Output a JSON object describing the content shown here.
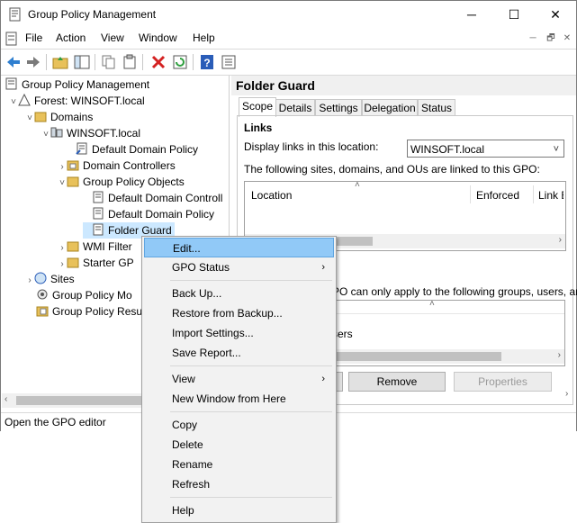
{
  "window": {
    "title": "Group Policy Management",
    "controls": {
      "minimize": "─",
      "maximize": "☐",
      "close": "✕"
    }
  },
  "menubar": {
    "items": [
      "File",
      "Action",
      "View",
      "Window",
      "Help"
    ],
    "mdi": {
      "minimize": "─",
      "restore": "🗗",
      "close": "✕"
    }
  },
  "tree": {
    "items": [
      {
        "label": "Group Policy Management",
        "icon": "gpm-icon"
      },
      {
        "label": "Forest: WINSOFT.local",
        "icon": "forest-icon"
      },
      {
        "label": "Domains",
        "icon": "folder-icon"
      },
      {
        "label": "WINSOFT.local",
        "icon": "domain-icon"
      },
      {
        "label": "Default Domain Policy",
        "icon": "gpo-link-icon"
      },
      {
        "label": "Domain Controllers",
        "icon": "ou-icon"
      },
      {
        "label": "Group Policy Objects",
        "icon": "folder-icon"
      },
      {
        "label": "Default Domain Controll",
        "icon": "gpo-icon"
      },
      {
        "label": "Default Domain Policy",
        "icon": "gpo-icon"
      },
      {
        "label": "Folder Guard",
        "icon": "gpo-icon"
      },
      {
        "label": "WMI Filter",
        "icon": "folder-icon"
      },
      {
        "label": "Starter GP",
        "icon": "folder-icon"
      },
      {
        "label": "Sites",
        "icon": "sites-icon"
      },
      {
        "label": "Group Policy Mo",
        "icon": "modeling-icon"
      },
      {
        "label": "Group Policy Resu",
        "icon": "results-icon"
      }
    ]
  },
  "status": {
    "text": "Open the GPO editor"
  },
  "right": {
    "title": "Folder Guard",
    "tabs": [
      "Scope",
      "Details",
      "Settings",
      "Delegation",
      "Status"
    ],
    "links_heading": "Links",
    "display_links_label": "Display links in this location:",
    "location_value": "WINSOFT.local",
    "linked_text": "The following sites, domains, and OUs are linked to this GPO:",
    "columns": [
      "Location",
      "Enforced",
      "Link E"
    ],
    "filter_text": "PO can only apply to the following groups, users, and c",
    "filter_row": "sers",
    "buttons": {
      "add": "",
      "remove": "Remove",
      "properties": "Properties"
    }
  },
  "context_menu": {
    "items": [
      {
        "label": "Edit...",
        "highlight": true
      },
      {
        "label": "GPO Status",
        "submenu": true
      },
      {
        "sep": true
      },
      {
        "label": "Back Up..."
      },
      {
        "label": "Restore from Backup..."
      },
      {
        "label": "Import Settings..."
      },
      {
        "label": "Save Report..."
      },
      {
        "sep": true
      },
      {
        "label": "View",
        "submenu": true
      },
      {
        "label": "New Window from Here"
      },
      {
        "sep": true
      },
      {
        "label": "Copy"
      },
      {
        "label": "Delete"
      },
      {
        "label": "Rename"
      },
      {
        "label": "Refresh"
      },
      {
        "sep": true
      },
      {
        "label": "Help"
      }
    ],
    "submenu_glyph": "›"
  },
  "colors": {
    "highlight": "#91c9f7",
    "selected_tree": "#cce8ff",
    "accent_blue": "#1a73c8"
  }
}
